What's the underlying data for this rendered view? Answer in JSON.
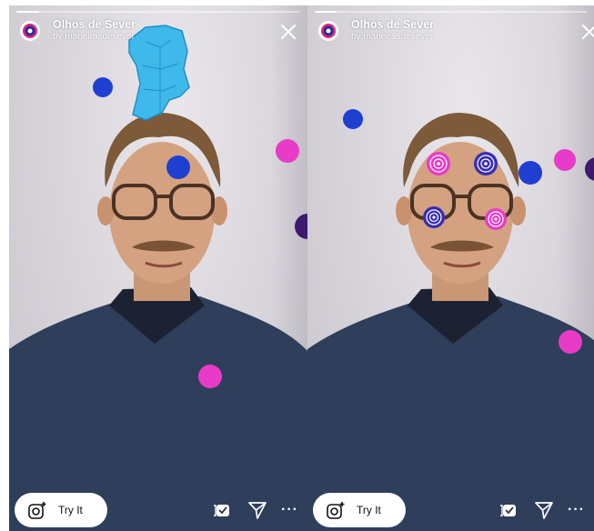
{
  "effect": {
    "title": "Olhos de Sever",
    "author": "by maneirasdesever"
  },
  "footer": {
    "try_label": "Try It",
    "more_label": "···"
  },
  "progress_fraction": 0.08,
  "icons": {
    "effect_logo": "eye-logo-icon",
    "close": "close-icon",
    "camera": "camera-icon",
    "save": "save-icon",
    "send": "send-icon",
    "more": "more-icon"
  },
  "colors": {
    "sphere_blue": "#1f3fd1",
    "sphere_magenta": "#e83bc8",
    "sphere_dark_purple": "#3c1a6e",
    "map_cyan": "#3fb8ea",
    "sweater": "#2f3f5c"
  }
}
